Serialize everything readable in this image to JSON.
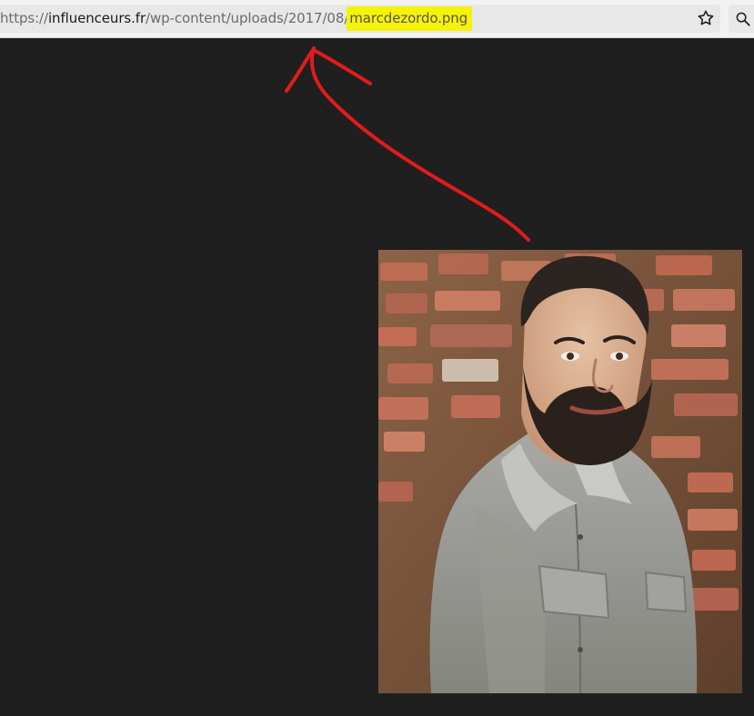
{
  "browser": {
    "url_prefix": "https://",
    "url_domain": "influenceurs.fr",
    "url_path": "/wp-content/uploads/2017/08/",
    "url_file": "marcdezordo.png"
  },
  "icons": {
    "bookmark": "star-icon",
    "search": "search-icon"
  },
  "colors": {
    "page_background": "#1f1f1f",
    "address_bar": "#e8e8e8",
    "highlight": "#f6f20a",
    "annotation_arrow": "#e21b1b"
  }
}
